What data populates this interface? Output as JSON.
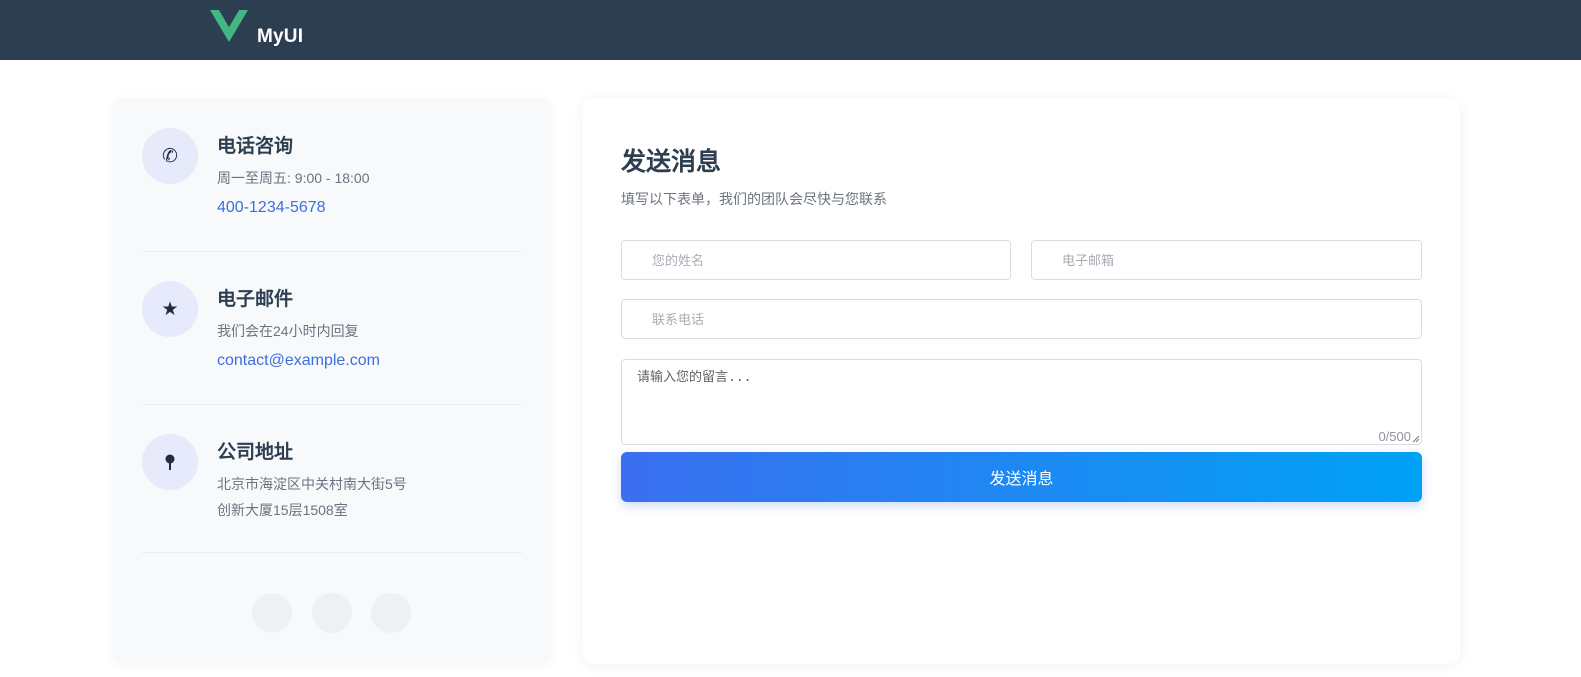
{
  "header": {
    "brand": "MyUI",
    "logo_icon": "vue-v-logo-icon",
    "background": "#2c3e50",
    "logo_colors": [
      "#41b883",
      "#35495e"
    ]
  },
  "contact_info": {
    "phone": {
      "icon": "phone-icon",
      "icon_glyph": "✆",
      "title": "电话咨询",
      "desc": "周一至周五: 9:00 - 18:00",
      "link": "400-1234-5678"
    },
    "email": {
      "icon": "star-icon",
      "icon_glyph": "★",
      "title": "电子邮件",
      "desc": "我们会在24小时内回复",
      "link": "contact@example.com"
    },
    "address": {
      "icon": "location-pin-icon",
      "icon_glyph": "📍",
      "title": "公司地址",
      "line1": "北京市海淀区中关村南大街5号",
      "line2": "创新大厦15层1508室"
    },
    "social_icons": [
      "social-icon-1",
      "social-icon-2",
      "social-icon-3"
    ]
  },
  "form": {
    "title": "发送消息",
    "subtitle": "填写以下表单，我们的团队会尽快与您联系",
    "name_placeholder": "您的姓名",
    "email_placeholder": "电子邮箱",
    "phone_placeholder": "联系电话",
    "message_placeholder": "请输入您的留言...",
    "counter": "0/500",
    "submit_label": "发送消息",
    "accent_start": "#3b6ff0",
    "accent_end": "#00a2f5",
    "link_color": "#3b6fe0"
  }
}
